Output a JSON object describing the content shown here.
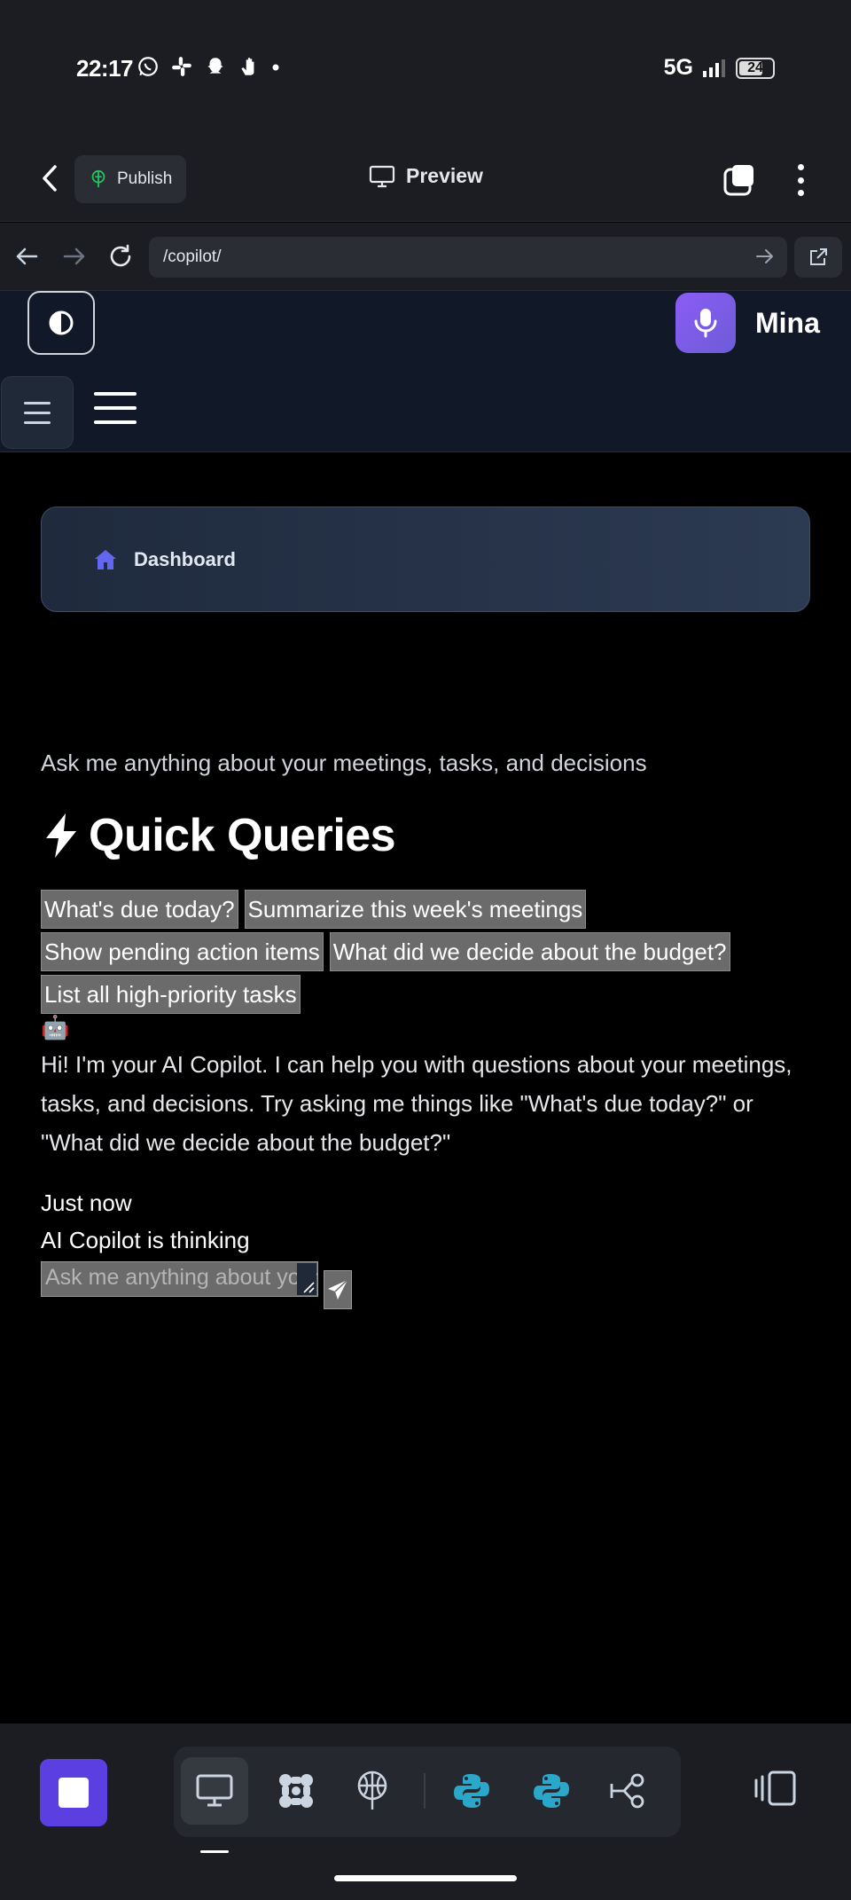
{
  "status_bar": {
    "time": "22:17",
    "network": "5G",
    "battery": "24",
    "notification_icons": [
      "whatsapp-icon",
      "slack-icon",
      "snapchat-icon",
      "hand-icon",
      "dot-icon"
    ]
  },
  "browser_bar": {
    "publish_label": "Publish",
    "preview_label": "Preview",
    "url": "/copilot/"
  },
  "site_header": {
    "user_name": "Mina"
  },
  "nav": {
    "dashboard_label": "Dashboard"
  },
  "main": {
    "subtitle": "Ask me anything about your meetings, tasks, and decisions",
    "quick_queries_title": "Quick Queries",
    "quick_queries": [
      "What's due today?",
      "Summarize this week's meetings",
      "Show pending action items",
      "What did we decide about the budget?",
      "List all high-priority tasks"
    ],
    "bot_avatar": "🤖",
    "welcome_message": "Hi! I'm your AI Copilot. I can help you with questions about your meetings, tasks, and decisions. Try asking me things like \"What's due today?\" or \"What did we decide about the budget?\"",
    "message_time": "Just now",
    "thinking_text": "AI Copilot is thinking",
    "input_placeholder": "Ask me anything about your meetings..."
  },
  "colors": {
    "accent": "#5b3fe0",
    "mic_gradient": "#8b5cf6",
    "dashboard_icon": "#6366f1",
    "python_icon": "#2aa7c9",
    "chip_bg": "#6b6b6b"
  }
}
